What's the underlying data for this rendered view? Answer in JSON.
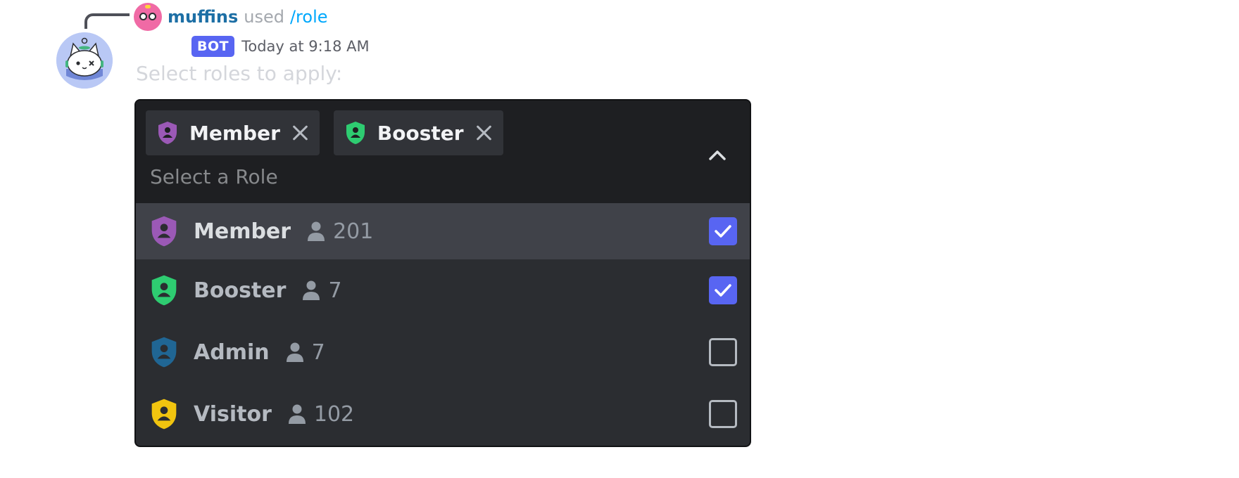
{
  "reply": {
    "username": "muffins",
    "used_text": "used",
    "command": "/role"
  },
  "message": {
    "bot_tag": "BOT",
    "timestamp": "Today at 9:18 AM",
    "prompt": "Select roles to apply:"
  },
  "select_menu": {
    "placeholder": "Select a Role",
    "selected_chips": [
      {
        "label": "Member",
        "color": "#9b59b6"
      },
      {
        "label": "Booster",
        "color": "#2ecc71"
      }
    ],
    "options": [
      {
        "label": "Member",
        "count": "201",
        "color": "#9b59b6",
        "checked": true
      },
      {
        "label": "Booster",
        "count": "7",
        "color": "#2ecc71",
        "checked": true
      },
      {
        "label": "Admin",
        "count": "7",
        "color": "#206694",
        "checked": false
      },
      {
        "label": "Visitor",
        "count": "102",
        "color": "#f1c40f",
        "checked": false
      }
    ]
  },
  "icons": {
    "role": "shield-person-icon",
    "members": "person-icon",
    "remove": "close-icon",
    "collapse": "chevron-up-icon",
    "check": "checkmark-icon"
  },
  "colors": {
    "accent": "#5865f2",
    "menu_bg": "#2b2d31",
    "menu_top_bg": "#1e1f22",
    "username": "#1d6fa5",
    "command": "#00a8fc"
  }
}
